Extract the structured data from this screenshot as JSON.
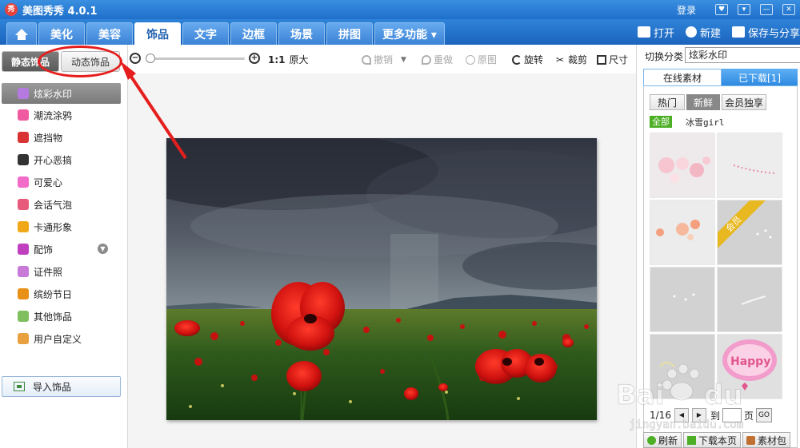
{
  "app": {
    "title": "美图秀秀 4.0.1",
    "logo_text": "秀"
  },
  "titlebar": {
    "login": "登录"
  },
  "menu": {
    "tabs": [
      {
        "label": "美化"
      },
      {
        "label": "美容"
      },
      {
        "label": "饰品"
      },
      {
        "label": "文字"
      },
      {
        "label": "边框"
      },
      {
        "label": "场景"
      },
      {
        "label": "拼图"
      },
      {
        "label": "更多功能 ▾"
      }
    ],
    "open": "打开",
    "new": "新建",
    "save": "保存与分享"
  },
  "leftpanel": {
    "static_tab": "静态饰品",
    "dynamic_tab": "动态饰品",
    "categories": [
      {
        "label": "炫彩水印",
        "color": "#b57ae0"
      },
      {
        "label": "潮流涂鸦",
        "color": "#f05aa0"
      },
      {
        "label": "遮挡物",
        "color": "#d93333"
      },
      {
        "label": "开心恶搞",
        "color": "#333333"
      },
      {
        "label": "可爱心",
        "color": "#f26bc8"
      },
      {
        "label": "会话气泡",
        "color": "#e85a7a"
      },
      {
        "label": "卡通形象",
        "color": "#f0a818"
      },
      {
        "label": "配饰",
        "color": "#c040c0"
      },
      {
        "label": "证件照",
        "color": "#c87ad8"
      },
      {
        "label": "缤纷节日",
        "color": "#e89018"
      },
      {
        "label": "其他饰品",
        "color": "#7fbf5f"
      },
      {
        "label": "用户自定义",
        "color": "#e8a040"
      }
    ],
    "import_label": "导入饰品"
  },
  "toolbar": {
    "ratio": "1:1",
    "original_size": "原大",
    "undo": "撤销",
    "redo": "重做",
    "original": "原图",
    "rotate": "旋转",
    "crop": "裁剪",
    "size": "尺寸"
  },
  "rightpanel": {
    "switch_label": "切换分类",
    "switch_value": "炫彩水印",
    "tab_online": "在线素材",
    "tab_downloaded": "已下载[1]",
    "filters": [
      "热门",
      "新鲜",
      "会员独享"
    ],
    "all_badge": "全部",
    "tag": "冰雪girl",
    "member_ribbon": "会员",
    "happy_text": "Happy",
    "pager": {
      "page_info": "1/16",
      "goto_prefix": "到",
      "goto_suffix": "页",
      "go": "GO"
    },
    "bottom_buttons": [
      "刷新",
      "下载本页",
      "素材包"
    ]
  }
}
